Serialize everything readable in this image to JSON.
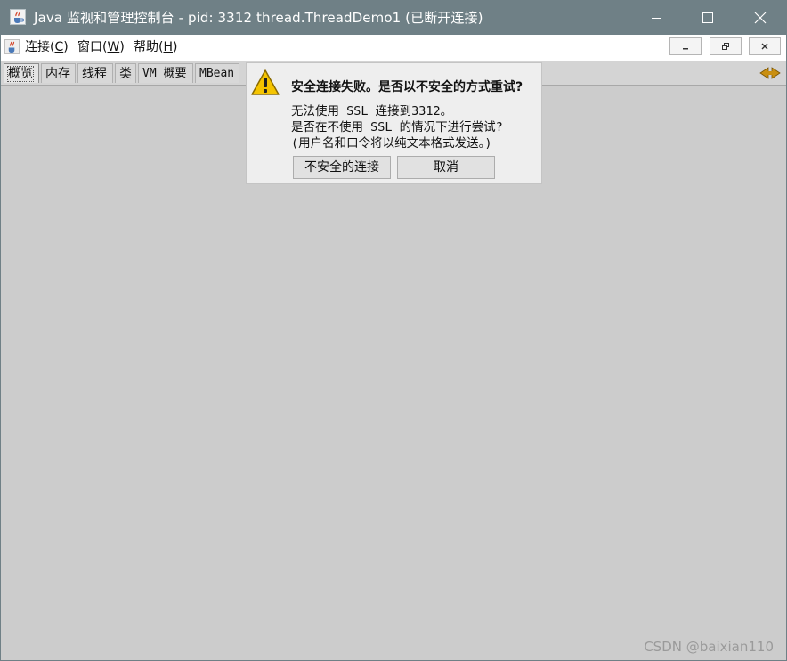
{
  "window": {
    "title": "Java 监视和管理控制台 - pid: 3312 thread.ThreadDemo1 (已断开连接)"
  },
  "menubar": {
    "items": [
      {
        "label": "连接(",
        "key": "C",
        "suffix": ")"
      },
      {
        "label": "窗口(",
        "key": "W",
        "suffix": ")"
      },
      {
        "label": "帮助(",
        "key": "H",
        "suffix": ")"
      }
    ]
  },
  "tabs": [
    {
      "label": "概览",
      "active": true
    },
    {
      "label": "内存",
      "active": false
    },
    {
      "label": "线程",
      "active": false
    },
    {
      "label": "类",
      "active": false
    },
    {
      "label": "VM 概要",
      "active": false
    },
    {
      "label": "MBean",
      "active": false
    }
  ],
  "dialog": {
    "heading": "安全连接失败。是否以不安全的方式重试?",
    "line1": "无法使用 SSL 连接到3312。",
    "line2": "是否在不使用 SSL 的情况下进行尝试?",
    "line3": "(用户名和口令将以纯文本格式发送。)",
    "insecure_button": "不安全的连接",
    "cancel_button": "取消"
  },
  "watermark": "CSDN @baixian110",
  "colors": {
    "titlebar": "#6f8086",
    "content": "#cccccc",
    "dialog_bg": "#eeeeee",
    "warning_yellow": "#f5c400"
  },
  "icons": {
    "app": "java-cup-icon",
    "warning": "warning-triangle-icon",
    "tab_scroll": "tab-scroll-arrows-icon"
  }
}
